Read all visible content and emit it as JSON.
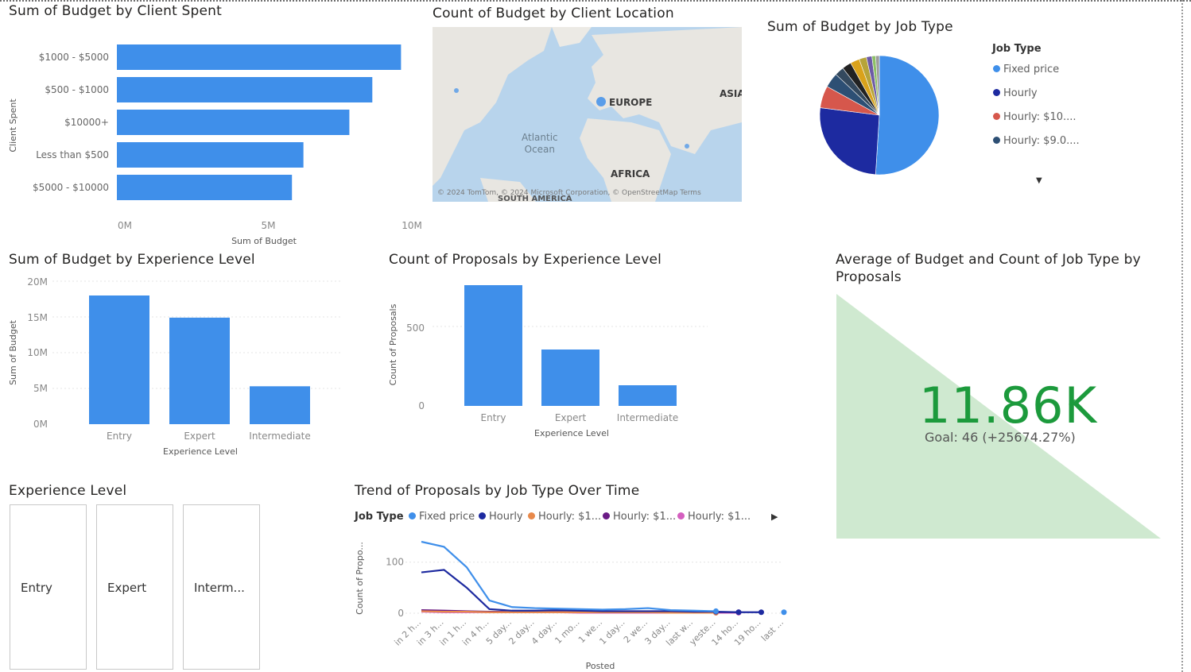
{
  "colors": {
    "bar": "#3f8fea",
    "fixed_price": "#3f8fea",
    "hourly": "#1d2aa0",
    "hourly_10": "#d6574c",
    "hourly_9": "#2d4f74",
    "trend_hourly_1a": "#e8894a",
    "trend_hourly_1b": "#6a1b85",
    "trend_hourly_1c": "#d45fbf",
    "kpi_green": "#1c9a3c",
    "kpi_fill": "#cfe9d0",
    "map_water": "#b8d4ec",
    "map_land": "#e8e6e1"
  },
  "chart_budget_client_spent": {
    "title": "Sum of Budget by Client Spent",
    "y_axis_label": "Client Spent",
    "x_axis_label": "Sum of Budget",
    "x_ticks": [
      "0M",
      "5M",
      "10M"
    ],
    "chart_data": {
      "type": "bar",
      "orientation": "horizontal",
      "categories": [
        "$1000 - $5000",
        "$500 - $1000",
        "$10000+",
        "Less than $500",
        "$5000 - $10000"
      ],
      "values": [
        9900000,
        8900000,
        8100000,
        6500000,
        6100000
      ],
      "xlim": [
        0,
        10000000
      ],
      "xlabel": "Sum of Budget",
      "ylabel": "Client Spent"
    }
  },
  "map_client_location": {
    "title": "Count of Budget by Client Location",
    "labels": {
      "europe": "EUROPE",
      "asia": "ASIA",
      "africa": "AFRICA",
      "ocean_line1": "Atlantic",
      "ocean_line2": "Ocean",
      "south_america": "SOUTH AMERICA"
    },
    "copyright": "© 2024 TomTom, © 2024 Microsoft Corporation, © OpenStreetMap  Terms"
  },
  "pie_job_type": {
    "title": "Sum of Budget by Job Type",
    "legend_title": "Job Type",
    "legend": [
      {
        "label": "Fixed price",
        "color": "#3f8fea"
      },
      {
        "label": "Hourly",
        "color": "#1d2aa0"
      },
      {
        "label": "Hourly: $10....",
        "color": "#d6574c"
      },
      {
        "label": "Hourly: $9.0....",
        "color": "#2d4f74"
      }
    ],
    "chart_data": {
      "type": "pie",
      "slices": [
        {
          "label": "Fixed price",
          "value": 51,
          "color": "#3f8fea"
        },
        {
          "label": "Hourly",
          "value": 26,
          "color": "#1d2aa0"
        },
        {
          "label": "Hourly: $10....",
          "value": 6,
          "color": "#d6574c"
        },
        {
          "label": "Hourly: $9.0....",
          "value": 4,
          "color": "#2d4f74"
        },
        {
          "label": "",
          "value": 2.5,
          "color": "#34495e"
        },
        {
          "label": "",
          "value": 2.5,
          "color": "#222222"
        },
        {
          "label": "",
          "value": 2.5,
          "color": "#d9a21b"
        },
        {
          "label": "",
          "value": 2,
          "color": "#b6a43a"
        },
        {
          "label": "",
          "value": 1.5,
          "color": "#6c5aa6"
        },
        {
          "label": "",
          "value": 1,
          "color": "#8dbf66"
        },
        {
          "label": "",
          "value": 1,
          "color": "#9b9b9b"
        }
      ]
    }
  },
  "chart_budget_experience": {
    "title": "Sum of Budget by Experience Level",
    "y_axis_label": "Sum of Budget",
    "x_axis_label": "Experience Level",
    "y_ticks": [
      "20M",
      "15M",
      "10M",
      "5M",
      "0M"
    ],
    "chart_data": {
      "type": "bar",
      "categories": [
        "Entry",
        "Expert",
        "Intermediate"
      ],
      "values": [
        18000000,
        14900000,
        5300000
      ],
      "ylim": [
        0,
        20000000
      ],
      "xlabel": "Experience Level",
      "ylabel": "Sum of Budget"
    }
  },
  "chart_proposals_experience": {
    "title": "Count of Proposals by Experience Level",
    "y_axis_label": "Count of Proposals",
    "x_axis_label": "Experience Level",
    "y_ticks": [
      "500",
      "0"
    ],
    "chart_data": {
      "type": "bar",
      "categories": [
        "Entry",
        "Expert",
        "Intermediate"
      ],
      "values": [
        760,
        355,
        130
      ],
      "ylim": [
        0,
        800
      ],
      "xlabel": "Experience Level",
      "ylabel": "Count of Proposals"
    }
  },
  "kpi_card": {
    "title_line1": "Average of Budget and Count of Job Type by",
    "title_line2": "Proposals",
    "value": "11.86K",
    "check": "✓",
    "goal": "Goal: 46 (+25674.27%)"
  },
  "slicer_experience": {
    "title": "Experience Level",
    "options": [
      "Entry",
      "Expert",
      "Interm..."
    ]
  },
  "trend_chart": {
    "title": "Trend of Proposals by Job Type Over Time",
    "legend_title": "Job Type",
    "legend": [
      {
        "label": "Fixed price",
        "color": "#3f8fea"
      },
      {
        "label": "Hourly",
        "color": "#1d2aa0"
      },
      {
        "label": "Hourly: $1...",
        "color": "#e8894a"
      },
      {
        "label": "Hourly: $1...",
        "color": "#6a1b85"
      },
      {
        "label": "Hourly: $1...",
        "color": "#d45fbf"
      }
    ],
    "y_axis_label": "Count of Propo...",
    "x_axis_label": "Posted",
    "y_ticks": [
      "100",
      "0"
    ],
    "chart_data": {
      "type": "line",
      "x": [
        "in 2 h...",
        "in 3 h...",
        "in 1 h...",
        "in 4 h...",
        "5 day...",
        "2 day...",
        "4 day...",
        "1 mo...",
        "1 we...",
        "1 day...",
        "2 we...",
        "3 day...",
        "last w...",
        "yeste...",
        "14 ho...",
        "19 ho...",
        "last ..."
      ],
      "ylim": [
        0,
        140
      ],
      "series": [
        {
          "name": "Fixed price",
          "values": [
            140,
            130,
            90,
            25,
            12,
            10,
            9,
            8,
            7,
            8,
            10,
            6,
            5,
            4,
            null,
            null,
            2
          ]
        },
        {
          "name": "Hourly",
          "values": [
            80,
            85,
            50,
            8,
            5,
            5,
            6,
            5,
            4,
            4,
            4,
            4,
            3,
            3,
            2,
            2,
            null
          ]
        },
        {
          "name": "Hourly: $1...",
          "values": [
            4,
            3,
            3,
            2,
            2,
            2,
            2,
            2,
            2,
            2,
            2,
            1,
            1,
            1,
            null,
            null,
            null
          ]
        },
        {
          "name": "Hourly: $1...",
          "values": [
            6,
            5,
            4,
            3,
            3,
            3,
            3,
            3,
            2,
            2,
            2,
            2,
            2,
            2,
            2,
            null,
            null
          ]
        },
        {
          "name": "Hourly: $1...",
          "values": [
            3,
            2,
            2,
            2,
            2,
            2,
            2,
            1,
            1,
            1,
            1,
            1,
            1,
            1,
            1,
            null,
            null
          ]
        }
      ]
    }
  }
}
